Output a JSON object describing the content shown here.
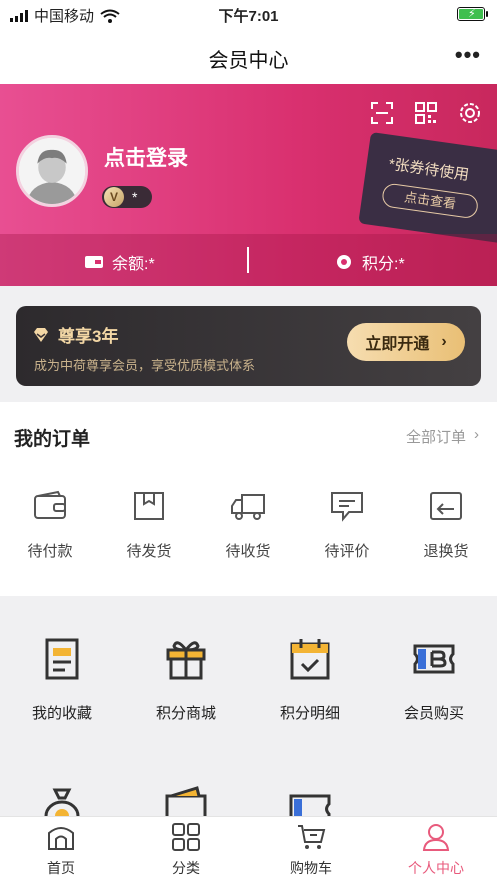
{
  "status_bar": {
    "carrier": "中国移动",
    "time": "下午7:01"
  },
  "nav": {
    "title": "会员中心",
    "more": "•••"
  },
  "member": {
    "login_text": "点击登录",
    "level_badge": "V",
    "level_star": "*",
    "coupon_text": "*张券待使用",
    "coupon_button": "点击查看",
    "balance_text": "余额:*",
    "points_text": "积分:*",
    "header_icons": [
      "scan-icon",
      "qrcode-icon",
      "settings-icon"
    ]
  },
  "vip_banner": {
    "title": "尊享3年",
    "description": "成为中荷尊享会员，享受优质模式体系",
    "button": "立即开通",
    "button_arrow": "›"
  },
  "orders": {
    "title": "我的订单",
    "all_orders": "全部订单",
    "all_arrow": "›",
    "items": [
      {
        "label": "待付款",
        "icon": "wallet-icon"
      },
      {
        "label": "待发货",
        "icon": "box-icon"
      },
      {
        "label": "待收货",
        "icon": "truck-icon"
      },
      {
        "label": "待评价",
        "icon": "comment-icon"
      },
      {
        "label": "退换货",
        "icon": "return-icon"
      }
    ]
  },
  "services": {
    "items": [
      {
        "label": "我的收藏",
        "icon": "favorites-icon"
      },
      {
        "label": "积分商城",
        "icon": "gift-icon"
      },
      {
        "label": "积分明细",
        "icon": "calendar-check-icon"
      },
      {
        "label": "会员购买",
        "icon": "member-card-icon"
      },
      {
        "label": "",
        "icon": "money-bag-icon"
      },
      {
        "label": "",
        "icon": "wallet-card-icon"
      },
      {
        "label": "",
        "icon": "ticket-icon"
      }
    ]
  },
  "tabbar": {
    "items": [
      {
        "label": "首页",
        "icon": "home-icon",
        "active": false
      },
      {
        "label": "分类",
        "icon": "category-icon",
        "active": false
      },
      {
        "label": "购物车",
        "icon": "cart-icon",
        "active": false
      },
      {
        "label": "个人中心",
        "icon": "user-icon",
        "active": true
      }
    ]
  },
  "colors": {
    "brand_pink": "#d9306f",
    "gold": "#e9bf75",
    "active_tab": "#e85a7c"
  }
}
